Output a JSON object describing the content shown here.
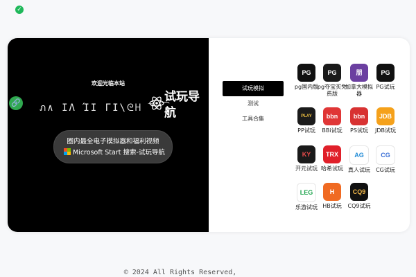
{
  "status_icon": "verified-check-icon",
  "hero": {
    "welcome": "欢迎光临本站",
    "glitch_text": "ภ∧ ΙΛ ΊΙ ΓΙ\\ᘓᕼ ̅⁻  ͡  ",
    "title": "试玩导航",
    "search_line1": "圈内最全电子模拟器和福利视频",
    "search_line2": "Microsoft Start 搜索-试玩导航",
    "link_icon": "link-icon",
    "atom_icon": "atom-icon"
  },
  "menu": {
    "items": [
      {
        "label": "试玩模拟",
        "active": true
      },
      {
        "label": "测试",
        "active": false
      },
      {
        "label": "工具合集",
        "active": false
      }
    ]
  },
  "apps": [
    {
      "label": "pg国内版",
      "icon": "PG",
      "bg": "#111111",
      "fg": "#ffffff"
    },
    {
      "label": "pg夺宝买免费版",
      "icon": "PG",
      "bg": "#1a1a1a",
      "fg": "#ffffff"
    },
    {
      "label": "加拿大模拟器",
      "icon": "朋",
      "bg": "#6b3fa0",
      "fg": "#ffffff"
    },
    {
      "label": "PG试玩",
      "icon": "PG",
      "bg": "#111111",
      "fg": "#ffffff"
    },
    {
      "label": "PP试玩",
      "icon": "PLAY",
      "bg": "#1b1b1b",
      "fg": "#f5c542"
    },
    {
      "label": "BBi试玩",
      "icon": "bbn",
      "bg": "#e03636",
      "fg": "#ffffff"
    },
    {
      "label": "PS试玩",
      "icon": "bbn",
      "bg": "#d83232",
      "fg": "#ffffff"
    },
    {
      "label": "JDB试玩",
      "icon": "JDB",
      "bg": "#f5a11b",
      "fg": "#ffffff"
    },
    {
      "label": "开元试玩",
      "icon": "KY",
      "bg": "#1a1a1a",
      "fg": "#e94b4b"
    },
    {
      "label": "哈希试玩",
      "icon": "TRX",
      "bg": "#e0202a",
      "fg": "#ffffff"
    },
    {
      "label": "真人试玩",
      "icon": "AG",
      "bg": "#ffffff",
      "fg": "#1f8ad6"
    },
    {
      "label": "CG试玩",
      "icon": "CG",
      "bg": "#ffffff",
      "fg": "#3a6fd6"
    },
    {
      "label": "乐游试玩",
      "icon": "LEG",
      "bg": "#ffffff",
      "fg": "#1aa34a"
    },
    {
      "label": "HB试玩",
      "icon": "H",
      "bg": "#f06a22",
      "fg": "#ffffff"
    },
    {
      "label": "CQ9试玩",
      "icon": "CQ9",
      "bg": "#111111",
      "fg": "#f2b84a"
    }
  ],
  "footer": "© 2024 All Rights Reserved,"
}
